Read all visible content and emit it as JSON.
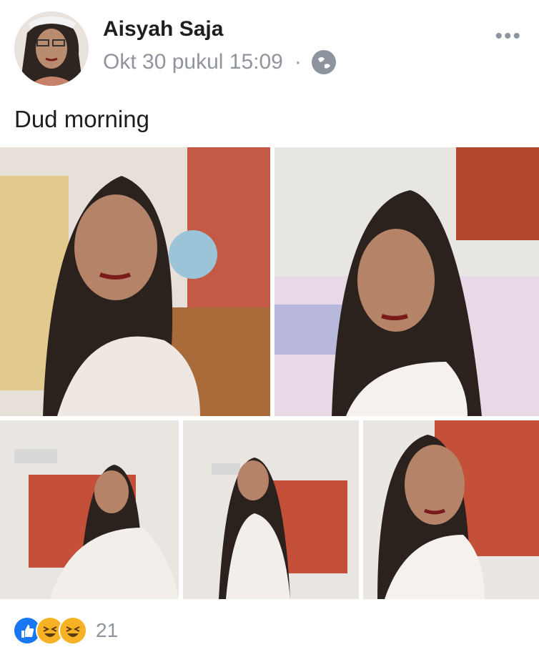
{
  "post": {
    "author": "Aisyah Saja",
    "timestamp": "Okt 30 pukul 15:09",
    "separator": "·",
    "privacy_icon": "globe-icon",
    "more_label": "•••",
    "caption": "Dud morning"
  },
  "reactions": {
    "icons": [
      "like-icon",
      "haha-icon",
      "haha-icon"
    ],
    "count": "21"
  },
  "colors": {
    "name": "#1c1e21",
    "meta": "#90949c",
    "like": "#1877f2",
    "haha": "#f7b125"
  }
}
